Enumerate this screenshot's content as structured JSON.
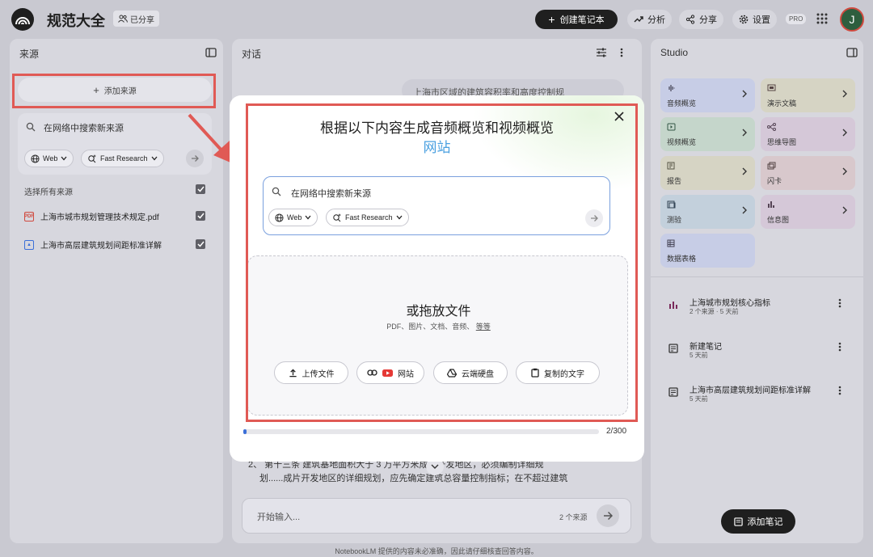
{
  "app": {
    "title": "规范大全",
    "shared_label": "已分享",
    "create_label": "创建笔记本",
    "analyze_label": "分析",
    "share_label": "分享",
    "settings_label": "设置",
    "pro_label": "PRO",
    "avatar_letter": "J"
  },
  "sources": {
    "header": "来源",
    "add_label": "添加来源",
    "search_placeholder": "在网络中搜索新来源",
    "web_chip": "Web",
    "research_chip": "Fast Research",
    "select_all_label": "选择所有来源",
    "items": [
      {
        "label": "上海市城市规划管理技术规定.pdf",
        "icon": "pdf-icon",
        "color": "#d04a3f"
      },
      {
        "label": "上海市高层建筑规划间距标准详解",
        "icon": "image-icon",
        "color": "#3b6fd8"
      }
    ]
  },
  "chat": {
    "header": "对话",
    "bubble_text": "上海市区域的建筑容积率和高度控制规",
    "partial_line_1": "2、 第十三条 建筑基地面积大于 3 万平方米成片开发地区，必须编制详细规",
    "partial_line_2": "划......成片开发地区的详细规划，应先确定建筑总容量控制指标；在不超过建筑",
    "input_placeholder": "开始输入...",
    "source_count": "2 个来源"
  },
  "studio": {
    "header": "Studio",
    "tiles": [
      {
        "label": "音频概览",
        "color": "#c7cde6"
      },
      {
        "label": "演示文稿",
        "color": "#d6d4c4"
      },
      {
        "label": "视频概览",
        "color": "#c5d6cb"
      },
      {
        "label": "思维导图",
        "color": "#d5c8d8"
      },
      {
        "label": "报告",
        "color": "#d6d4c4"
      },
      {
        "label": "闪卡",
        "color": "#d8c8cc"
      },
      {
        "label": "测验",
        "color": "#c3d0dc"
      },
      {
        "label": "信息图",
        "color": "#d5c8d8"
      },
      {
        "label": "数据表格",
        "color": "#c7cde6"
      }
    ],
    "notes": [
      {
        "title": "上海城市规划核心指标",
        "meta": "2 个来源 · 5 天前",
        "icon": "chart-icon"
      },
      {
        "title": "新建笔记",
        "meta": "5 天前",
        "icon": "note-icon"
      },
      {
        "title": "上海市高层建筑规划间距标准详解",
        "meta": "5 天前",
        "icon": "note-icon"
      }
    ],
    "add_note_label": "添加笔记"
  },
  "modal": {
    "title": "根据以下内容生成音频概览和视频概览",
    "subtitle": "网站",
    "search_placeholder": "在网络中搜索新来源",
    "web_chip": "Web",
    "research_chip": "Fast Research",
    "drop_title": "或拖放文件",
    "drop_subtitle": "PDF、图片、文档、音频、",
    "drop_more": "等等",
    "buttons": {
      "upload": "上传文件",
      "website": "网站",
      "drive": "云端硬盘",
      "paste": "复制的文字"
    },
    "progress_text": "2/300",
    "progress_fraction": 0.0067
  },
  "footer": "NotebookLM 提供的内容未必准确，因此请仔细核查回答内容。",
  "colors": {
    "highlight": "#e05a55",
    "accent": "#3b6fd8",
    "dark": "#1f1f1f"
  }
}
